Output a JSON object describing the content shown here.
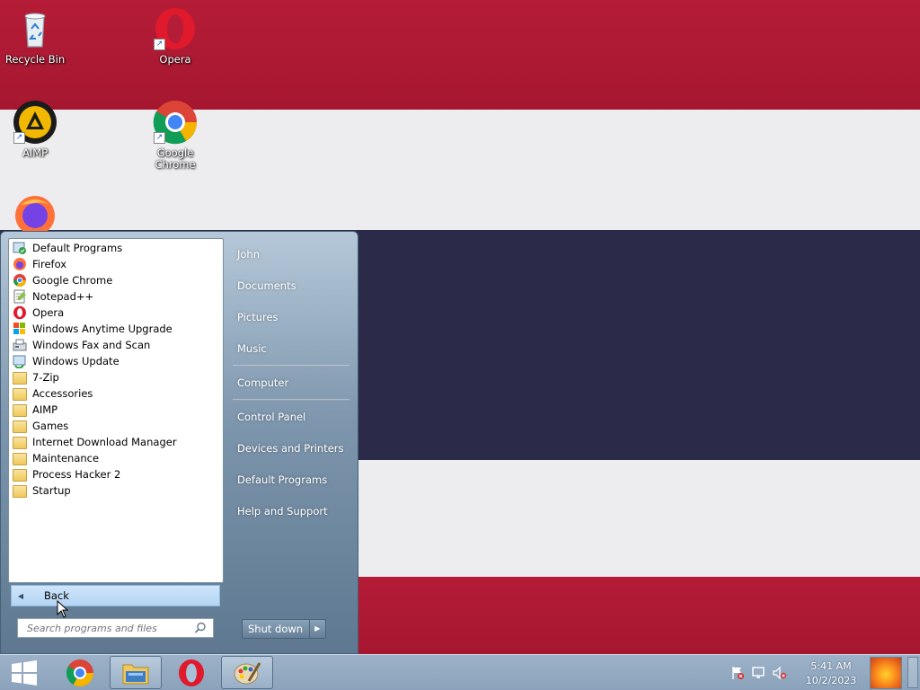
{
  "desktop": {
    "icons": [
      {
        "label": "Recycle Bin",
        "icon": "recycle-bin-icon"
      },
      {
        "label": "Opera",
        "icon": "opera-icon"
      },
      {
        "label": "AIMP",
        "icon": "aimp-icon"
      },
      {
        "label": "Google Chrome",
        "icon": "chrome-icon"
      },
      {
        "label": "",
        "icon": "firefox-icon"
      }
    ]
  },
  "start_menu": {
    "programs": [
      {
        "label": "Default Programs",
        "icon": "default-programs-icon"
      },
      {
        "label": "Firefox",
        "icon": "firefox-icon"
      },
      {
        "label": "Google Chrome",
        "icon": "chrome-icon"
      },
      {
        "label": "Notepad++",
        "icon": "notepad-plus-plus-icon"
      },
      {
        "label": "Opera",
        "icon": "opera-icon"
      },
      {
        "label": "Windows Anytime Upgrade",
        "icon": "windows-anytime-upgrade-icon"
      },
      {
        "label": "Windows Fax and Scan",
        "icon": "fax-scan-icon"
      },
      {
        "label": "Windows Update",
        "icon": "windows-update-icon"
      },
      {
        "label": "7-Zip",
        "icon": "folder-icon"
      },
      {
        "label": "Accessories",
        "icon": "folder-icon"
      },
      {
        "label": "AIMP",
        "icon": "folder-icon"
      },
      {
        "label": "Games",
        "icon": "folder-icon"
      },
      {
        "label": "Internet Download Manager",
        "icon": "folder-icon"
      },
      {
        "label": "Maintenance",
        "icon": "folder-icon"
      },
      {
        "label": "Process Hacker 2",
        "icon": "folder-icon"
      },
      {
        "label": "Startup",
        "icon": "folder-icon"
      }
    ],
    "back_label": "Back",
    "search_placeholder": "Search programs and files",
    "right_items": [
      {
        "label": "John"
      },
      {
        "label": "Documents"
      },
      {
        "label": "Pictures"
      },
      {
        "label": "Music"
      },
      {
        "label": "Computer"
      },
      {
        "label": "Control Panel"
      },
      {
        "label": "Devices and Printers"
      },
      {
        "label": "Default Programs"
      },
      {
        "label": "Help and Support"
      }
    ],
    "shutdown_label": "Shut down"
  },
  "taskbar": {
    "start_icon": "windows-start-icon",
    "pinned": [
      "chrome-icon",
      "file-explorer-icon",
      "opera-icon",
      "paint-icon"
    ],
    "tray": [
      "action-center-flag-icon",
      "network-icon",
      "volume-muted-icon"
    ],
    "time": "5:41 AM",
    "date": "10/2/2023"
  },
  "colors": {
    "wallpaper_red": "#b51c37",
    "wallpaper_white": "#ededf0",
    "wallpaper_navy": "#2c2a49",
    "back_highlight": "#b3d4f2"
  }
}
